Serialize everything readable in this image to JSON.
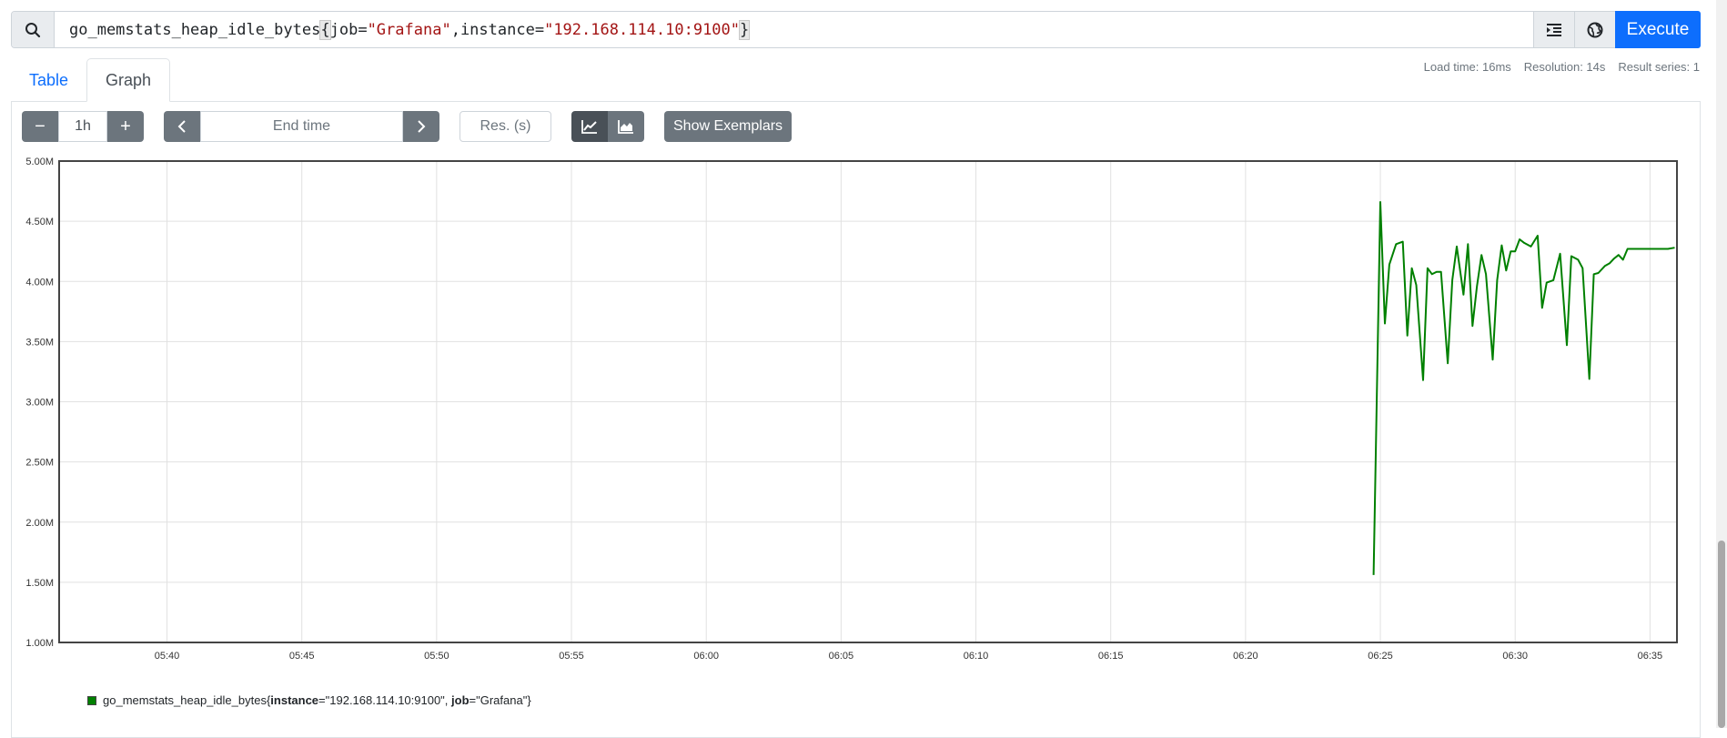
{
  "query": {
    "metric": "go_memstats_heap_idle_bytes",
    "open_brace": "{",
    "label1_key": "job",
    "label1_eq": "=",
    "label1_value": "\"Grafana\"",
    "comma": ",",
    "label2_key": "instance",
    "label2_eq": "=",
    "label2_value": "\"192.168.114.10:9100\"",
    "close_brace": "}",
    "execute_label": "Execute"
  },
  "tabs": {
    "table": "Table",
    "graph": "Graph"
  },
  "stats": {
    "load_time": "Load time: 16ms",
    "resolution": "Resolution: 14s",
    "result_series": "Result series: 1"
  },
  "controls": {
    "minus": "−",
    "range": "1h",
    "plus": "+",
    "end_time_placeholder": "End time",
    "resolution_placeholder": "Res. (s)",
    "show_exemplars": "Show Exemplars"
  },
  "legend": {
    "metric": "go_memstats_heap_idle_bytes",
    "open": "{",
    "k1": "instance",
    "v1": "=\"192.168.114.10:9100\", ",
    "k2": "job",
    "v2": "=\"Grafana\"",
    "close": "}"
  },
  "colors": {
    "series": "#008000",
    "accent": "#0d6efd"
  },
  "chart_data": {
    "type": "line",
    "ylim": [
      1000000,
      5000000
    ],
    "yticks": [
      1000000,
      1500000,
      2000000,
      2500000,
      3000000,
      3500000,
      4000000,
      4500000,
      5000000
    ],
    "ytick_labels": [
      "1.00M",
      "1.50M",
      "2.00M",
      "2.50M",
      "3.00M",
      "3.50M",
      "4.00M",
      "4.50M",
      "5.00M"
    ],
    "xlim": [
      "05:36",
      "06:36"
    ],
    "xticks": [
      "05:40",
      "05:45",
      "05:50",
      "05:55",
      "06:00",
      "06:05",
      "06:10",
      "06:15",
      "06:20",
      "06:25",
      "06:30",
      "06:35"
    ],
    "grid": true,
    "series": [
      {
        "name": "go_memstats_heap_idle_bytes{instance=\"192.168.114.10:9100\", job=\"Grafana\"}",
        "x": [
          "06:24:45",
          "06:25:00",
          "06:25:10",
          "06:25:20",
          "06:25:35",
          "06:25:50",
          "06:26:00",
          "06:26:10",
          "06:26:20",
          "06:26:35",
          "06:26:45",
          "06:26:55",
          "06:27:05",
          "06:27:15",
          "06:27:30",
          "06:27:40",
          "06:27:50",
          "06:28:05",
          "06:28:15",
          "06:28:25",
          "06:28:35",
          "06:28:45",
          "06:28:55",
          "06:29:10",
          "06:29:20",
          "06:29:30",
          "06:29:40",
          "06:29:50",
          "06:30:00",
          "06:30:10",
          "06:30:20",
          "06:30:35",
          "06:30:50",
          "06:31:00",
          "06:31:10",
          "06:31:25",
          "06:31:40",
          "06:31:55",
          "06:32:05",
          "06:32:20",
          "06:32:30",
          "06:32:45",
          "06:32:55",
          "06:33:05",
          "06:33:20",
          "06:33:30",
          "06:33:40",
          "06:33:50",
          "06:34:00",
          "06:34:10",
          "06:34:20",
          "06:34:35",
          "06:34:50",
          "06:35:05",
          "06:35:20",
          "06:35:30",
          "06:35:40",
          "06:35:55"
        ],
        "y": [
          1560000,
          4660000,
          3650000,
          4140000,
          4310000,
          4330000,
          3550000,
          4110000,
          3970000,
          3180000,
          4110000,
          4060000,
          4080000,
          4080000,
          3320000,
          4010000,
          4290000,
          3890000,
          4310000,
          3630000,
          3960000,
          4220000,
          4060000,
          3350000,
          4010000,
          4300000,
          4090000,
          4250000,
          4250000,
          4350000,
          4320000,
          4290000,
          4380000,
          3780000,
          3990000,
          4010000,
          4230000,
          3470000,
          4210000,
          4180000,
          4110000,
          3190000,
          4060000,
          4070000,
          4130000,
          4150000,
          4190000,
          4220000,
          4180000,
          4270000,
          4270000,
          4270000,
          4270000,
          4270000,
          4270000,
          4270000,
          4270000,
          4280000
        ]
      }
    ]
  }
}
